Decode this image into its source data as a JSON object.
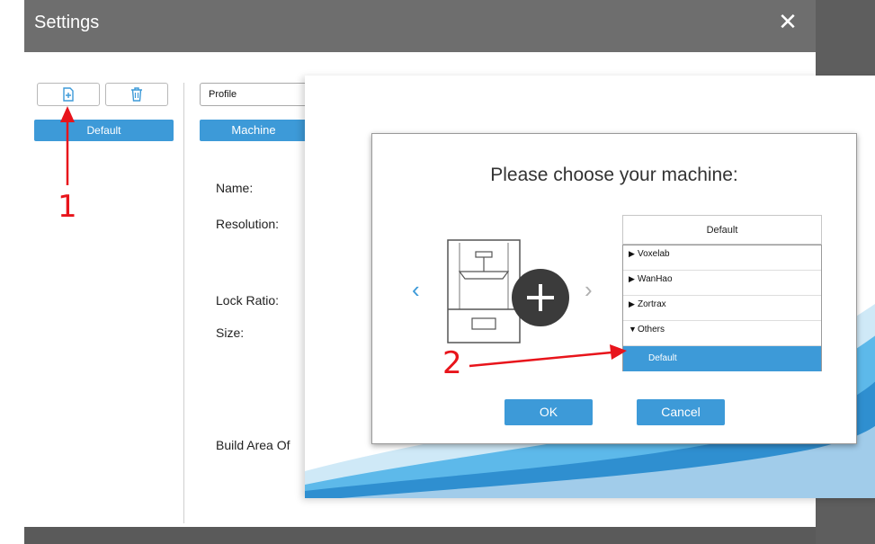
{
  "window": {
    "title": "Settings",
    "close_icon": "close-icon"
  },
  "left_panel": {
    "tool_buttons": [
      {
        "icon": "new-file-icon"
      },
      {
        "icon": "trash-icon"
      }
    ],
    "profiles": [
      "Default"
    ]
  },
  "right_panel": {
    "profile_select_value": "Profile",
    "tab": "Machine",
    "labels": {
      "name": "Name:",
      "resolution": "Resolution:",
      "lock_ratio": "Lock Ratio:",
      "size": "Size:",
      "build_area": "Build Area Of"
    }
  },
  "dialog": {
    "title": "Please choose your machine:",
    "prev_icon": "chevron-left-icon",
    "next_icon": "chevron-right-icon",
    "add_icon": "plus-icon",
    "tree_header": "Default",
    "tree_items": [
      {
        "label": "Voxelab",
        "expanded": false,
        "level": 0
      },
      {
        "label": "WanHao",
        "expanded": false,
        "level": 0
      },
      {
        "label": "Zortrax",
        "expanded": false,
        "level": 0
      },
      {
        "label": "Others",
        "expanded": true,
        "level": 0
      },
      {
        "label": "Default",
        "selected": true,
        "level": 1
      }
    ],
    "ok_label": "OK",
    "cancel_label": "Cancel"
  },
  "annotations": [
    "1",
    "2"
  ],
  "colors": {
    "accent": "#3d9ad8",
    "titlebar": "#6e6e6e",
    "annotation": "#e8141b"
  }
}
